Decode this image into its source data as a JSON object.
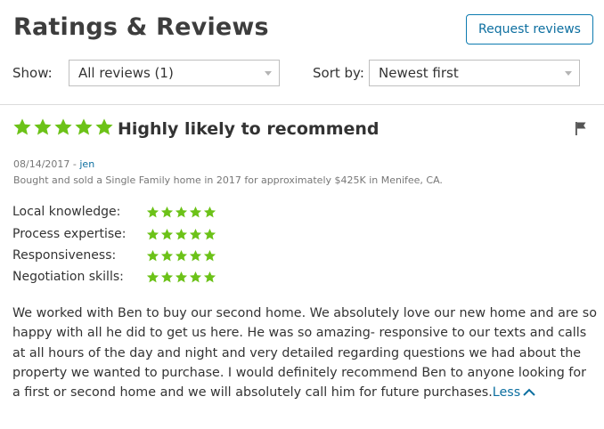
{
  "header": {
    "title": "Ratings & Reviews",
    "request_button": "Request reviews"
  },
  "filters": {
    "show_label": "Show:",
    "show_value": "All reviews (1)",
    "sort_label": "Sort by:",
    "sort_value": "Newest first"
  },
  "review": {
    "rating": 5,
    "headline": "Highly likely to recommend",
    "flag_icon": "flag-icon",
    "date": "08/14/2017",
    "separator": " - ",
    "author": "jen",
    "summary": "Bought and sold a Single Family home in 2017 for approximately $425K in Menifee, CA.",
    "sub_ratings": [
      {
        "label": "Local knowledge:",
        "rating": 5
      },
      {
        "label": "Process expertise:",
        "rating": 5
      },
      {
        "label": "Responsiveness:",
        "rating": 5
      },
      {
        "label": "Negotiation skills:",
        "rating": 5
      }
    ],
    "body": "We worked with Ben to buy our second home. We absolutely love our new home and are so happy with all he did to get us here. He was so amazing- responsive to our texts and calls at all hours of the day and night and very detailed regarding questions we had about the property we wanted to purchase. I  would definitely recommend Ben to anyone looking for a first or second home and we will absolutely call him for future purchases.",
    "less_label": "Less"
  },
  "colors": {
    "star": "#6cc218",
    "link": "#0d6fa0",
    "button_border": "#0d7bb0"
  }
}
